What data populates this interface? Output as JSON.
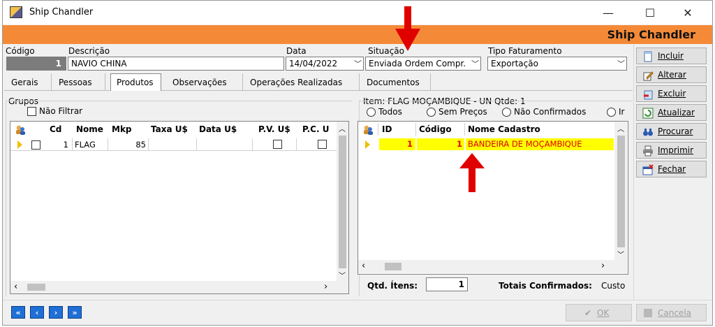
{
  "window": {
    "title": "Ship Chandler",
    "banner_title": "Ship Chandler",
    "minimize_glyph": "—",
    "maximize_glyph": "☐",
    "close_glyph": "✕"
  },
  "header": {
    "codigo_label": "Código",
    "codigo_value": "1",
    "descricao_label": "Descrição",
    "descricao_value": "NAVIO CHINA",
    "data_label": "Data",
    "data_value": "14/04/2022",
    "situacao_label": "Situação",
    "situacao_value": "Enviada Ordem Compr.",
    "tipo_label": "Tipo Faturamento",
    "tipo_value": "Exportação"
  },
  "tabs": [
    {
      "label": "Gerais"
    },
    {
      "label": "Pessoas"
    },
    {
      "label": "Produtos"
    },
    {
      "label": "Observações"
    },
    {
      "label": "Operações Realizadas"
    },
    {
      "label": "Documentos"
    }
  ],
  "left_panel": {
    "group_label": "Grupos",
    "no_filter_label": "Não Filtrar",
    "columns": [
      "Cd",
      "Nome",
      "Mkp",
      "Taxa U$",
      "Data U$",
      "P.V. U$",
      "P.C. U"
    ],
    "rows": [
      {
        "cd": "1",
        "nome": "FLAG",
        "mkp": "85",
        "taxa": "",
        "data": ""
      }
    ]
  },
  "right_panel": {
    "item_label": "Item: FLAG MOÇAMBIQUE - UN Qtde: 1",
    "filters": [
      "Todos",
      "Sem Preços",
      "Não Confirmados",
      "Ir"
    ],
    "columns": [
      "ID",
      "Código",
      "Nome Cadastro"
    ],
    "rows": [
      {
        "id": "1",
        "codigo": "1",
        "nome": "BANDEIRA DE MOÇAMBIQUE"
      }
    ],
    "qtd_itens_label": "Qtd. Ítens:",
    "qtd_itens_value": "1",
    "totais_label": "Totais Confirmados:",
    "totais_value": "Custo"
  },
  "side_buttons": [
    {
      "label": "Incluir",
      "icon": "document-new-icon"
    },
    {
      "label": "Alterar",
      "icon": "pencil-edit-icon"
    },
    {
      "label": "Excluir",
      "icon": "delete-icon"
    },
    {
      "label": "Atualizar",
      "icon": "refresh-icon"
    },
    {
      "label": "Procurar",
      "icon": "binoculars-icon"
    },
    {
      "label": "Imprimir",
      "icon": "printer-icon"
    },
    {
      "label": "Fechar",
      "icon": "close-window-icon"
    }
  ],
  "nav_buttons": [
    "first-record-icon",
    "previous-record-icon",
    "next-record-icon",
    "last-record-icon"
  ],
  "footer": {
    "ok_label": "OK",
    "cancel_label": "Cancela"
  },
  "colors": {
    "banner": "#f48a38",
    "highlight_row": "#ffff00",
    "highlight_text": "#e00000",
    "annotation_arrow": "#e00000"
  }
}
